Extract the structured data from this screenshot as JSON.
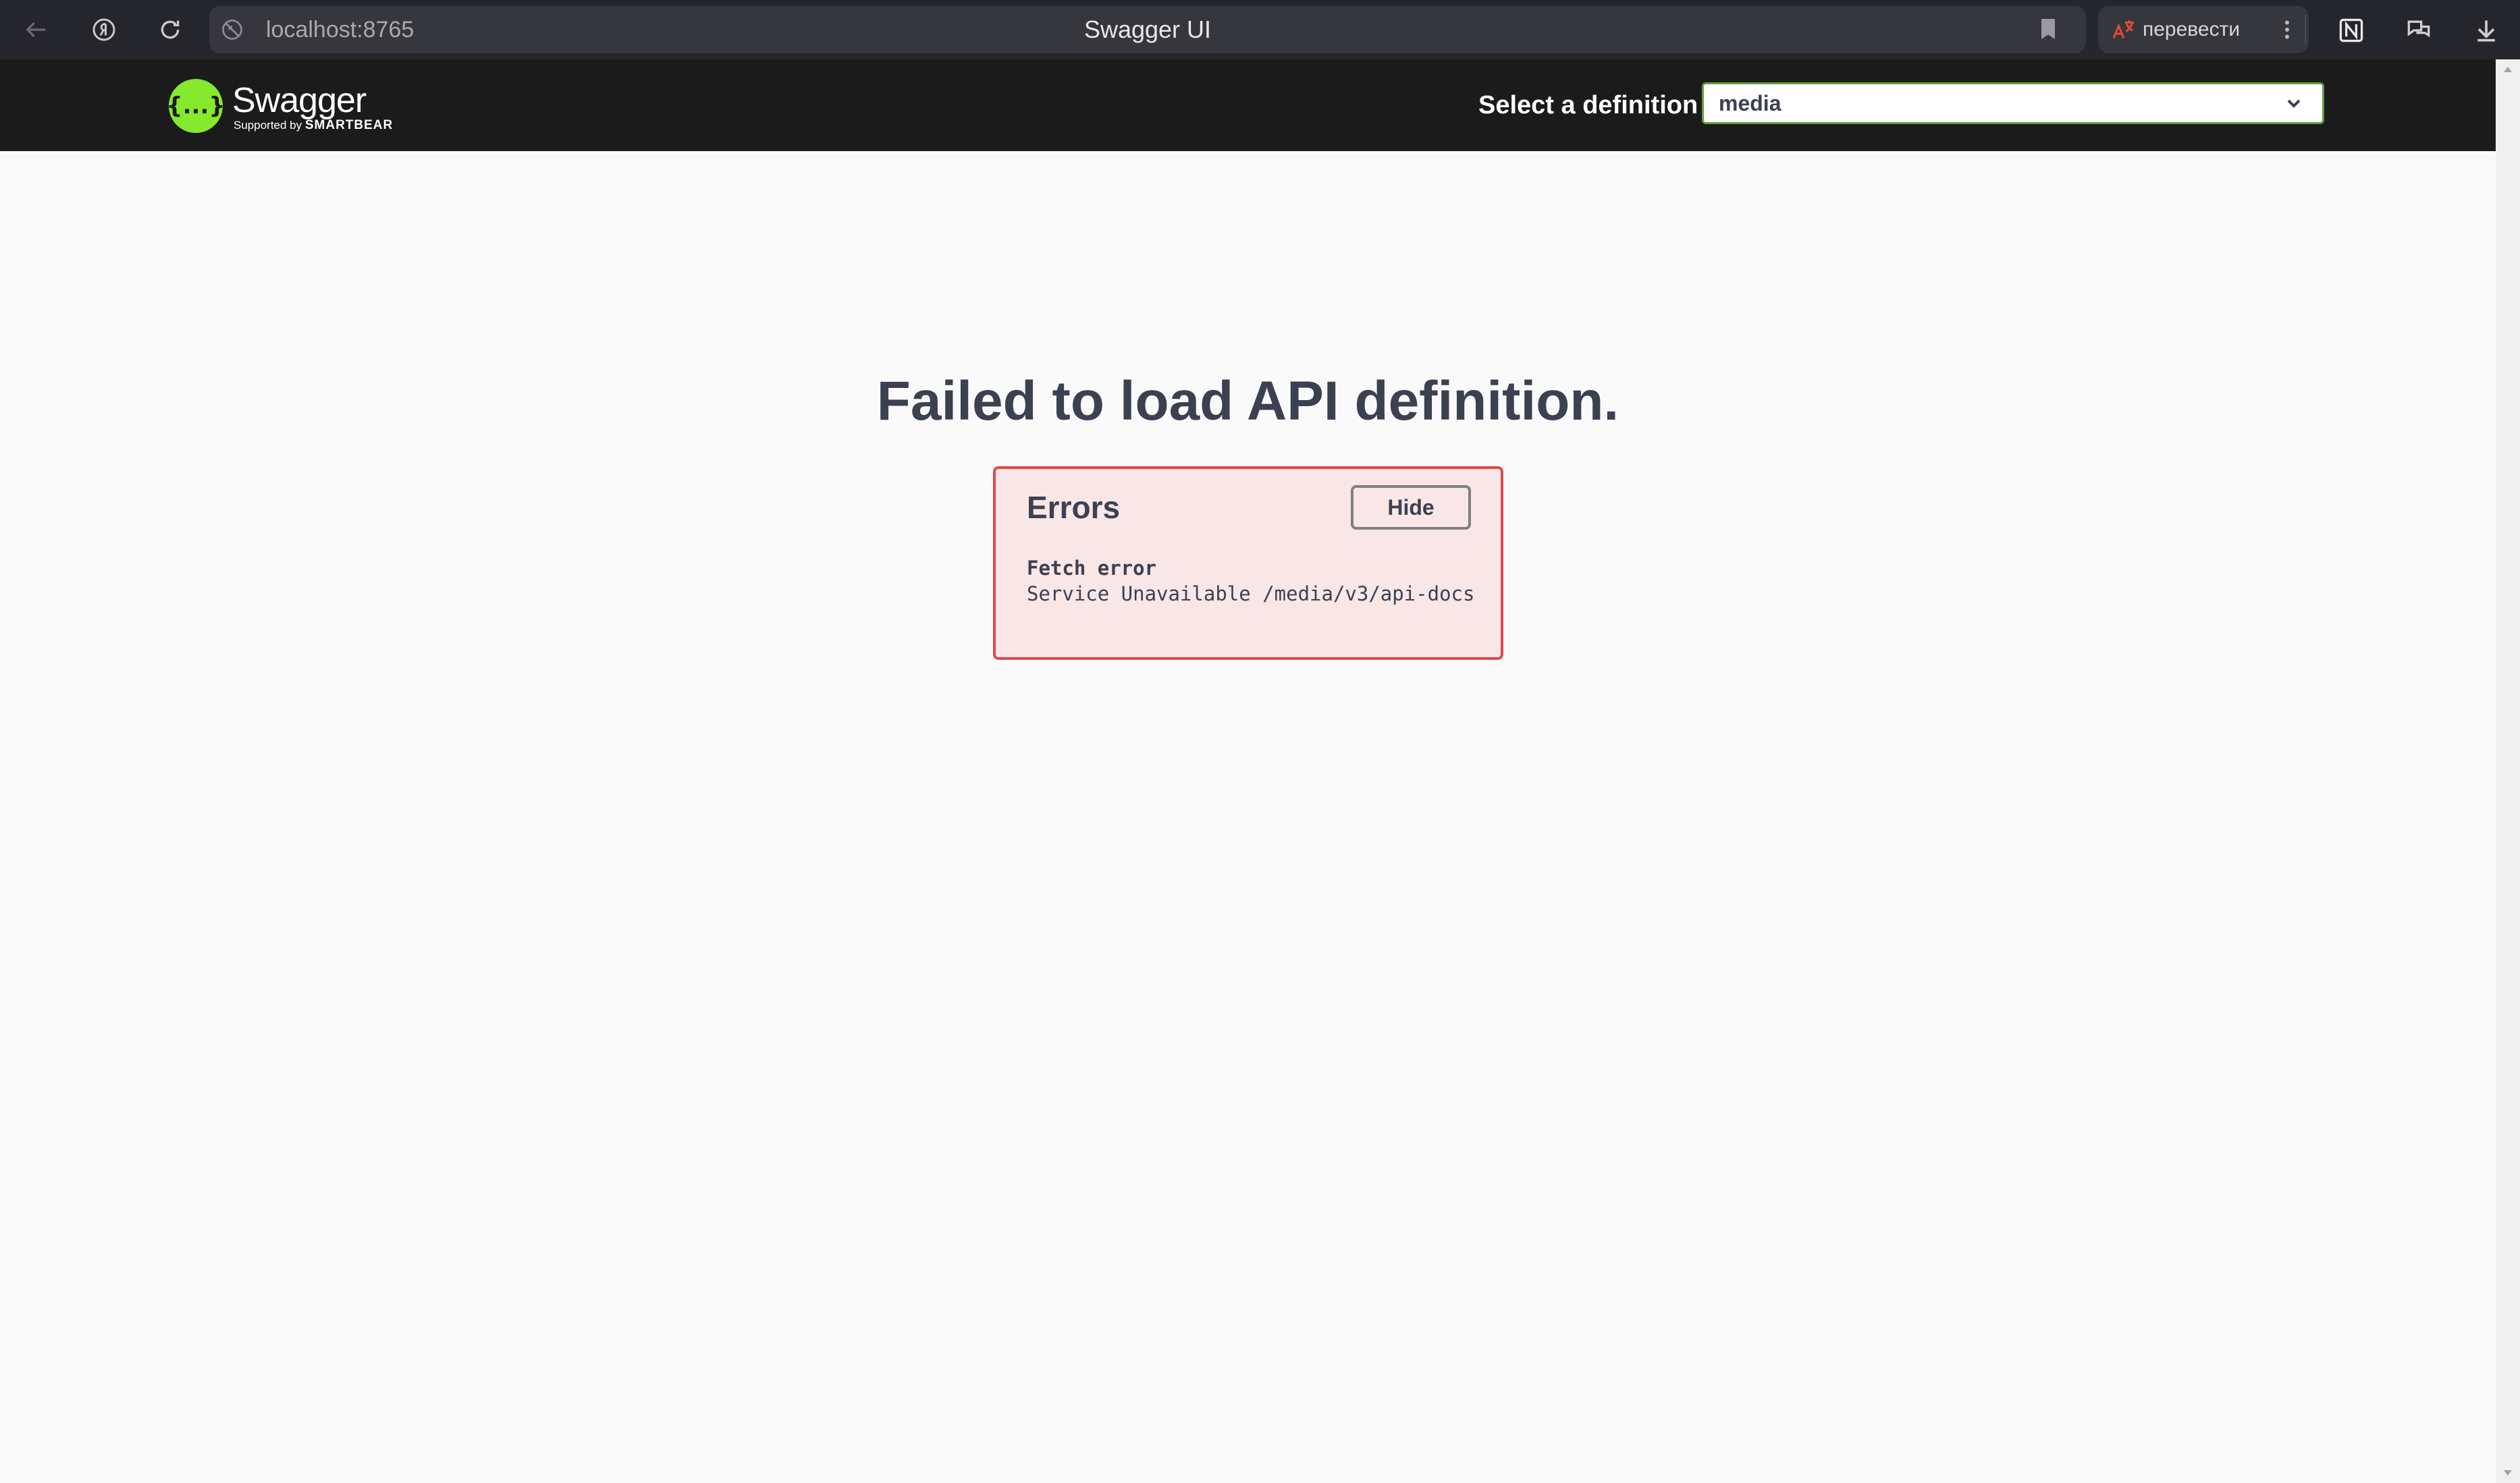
{
  "browser": {
    "url": "localhost:8765",
    "tab_title": "Swagger UI",
    "translate_label": "перевести",
    "icons": {
      "back": "back-arrow-icon",
      "yandex": "yandex-icon",
      "reload": "reload-icon",
      "site": "site-settings-icon",
      "bookmark": "bookmark-icon",
      "translate": "translate-icon",
      "menu": "more-menu-icon",
      "notion": "notion-icon",
      "extension": "chat-extension-icon",
      "download": "download-icon"
    }
  },
  "topbar": {
    "logo_name": "Swagger",
    "logo_sub_prefix": "Supported by ",
    "logo_sub_brand": "SMARTBEAR",
    "logo_glyph": "{...}",
    "definition_label": "Select a definition",
    "definition_value": "media"
  },
  "main": {
    "title": "Failed to load API definition."
  },
  "errors": {
    "heading": "Errors",
    "hide_label": "Hide",
    "items": [
      {
        "title": "Fetch error",
        "message": "Service Unavailable /media/v3/api-docs"
      }
    ]
  },
  "colors": {
    "topbar_bg": "#1b1b1b",
    "swagger_green": "#85ea2d",
    "select_border": "#62a03f",
    "error_border": "#e04848",
    "text": "#3b4151"
  }
}
